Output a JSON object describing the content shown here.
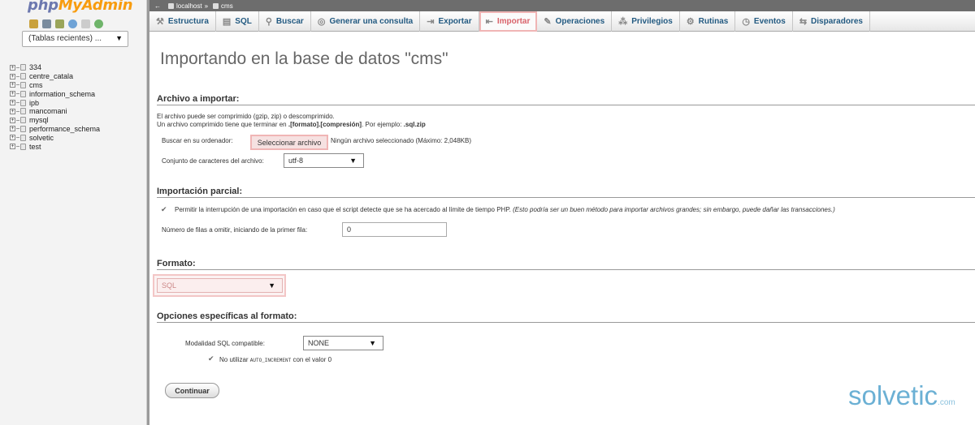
{
  "nav": {
    "logo_a": "php",
    "logo_b": "MyAdmin",
    "recent_label": "(Tablas recientes) ...",
    "databases": [
      "334",
      "centre_catala",
      "cms",
      "information_schema",
      "ipb",
      "mancomani",
      "mysql",
      "performance_schema",
      "solvetic",
      "test"
    ]
  },
  "breadcrumb": {
    "server": "localhost",
    "sep": "»",
    "db": "cms"
  },
  "tabs": [
    {
      "label": "Estructura",
      "icon": "structure-icon"
    },
    {
      "label": "SQL",
      "icon": "sql-icon"
    },
    {
      "label": "Buscar",
      "icon": "search-icon"
    },
    {
      "label": "Generar una consulta",
      "icon": "query-icon"
    },
    {
      "label": "Exportar",
      "icon": "export-icon"
    },
    {
      "label": "Importar",
      "icon": "import-icon"
    },
    {
      "label": "Operaciones",
      "icon": "wrench-icon"
    },
    {
      "label": "Privilegios",
      "icon": "privileges-icon"
    },
    {
      "label": "Rutinas",
      "icon": "routines-icon"
    },
    {
      "label": "Eventos",
      "icon": "clock-icon"
    },
    {
      "label": "Disparadores",
      "icon": "triggers-icon"
    }
  ],
  "page": {
    "title": "Importando en la base de datos \"cms\"",
    "file_section": "Archivo a importar:",
    "file_note1": "El archivo puede ser comprimido (gzip, zip) o descomprimido.",
    "file_note2_a": "Un archivo comprimido tiene que terminar en ",
    "file_note2_b": ".[formato].[compresión]",
    "file_note2_c": ". Por ejemplo: ",
    "file_note2_d": ".sql.zip",
    "browse_label": "Buscar en su ordenador:",
    "browse_button": "Seleccionar archivo",
    "no_file": "Ningún archivo seleccionado (Máximo: 2,048KB)",
    "charset_label": "Conjunto de caracteres del archivo:",
    "charset_value": "utf-8",
    "partial_section": "Importación parcial:",
    "allow_interrupt": "Permitir la interrupción de una importación en caso que el script detecte que se ha acercado al límite de tiempo PHP.",
    "allow_interrupt_note": "(Esto podría ser un buen método para importar archivos grandes; sin embargo, puede dañar las transacciones.)",
    "skip_label": "Número de filas a omitir, iniciando de la primer fila:",
    "skip_value": "0",
    "format_section": "Formato:",
    "format_value": "SQL",
    "options_section": "Opciones específicas al formato:",
    "sql_mode_label": "Modalidad SQL compatible:",
    "sql_mode_value": "NONE",
    "no_auto_a": "No utilizar ",
    "no_auto_b": "AUTO_INCREMENT",
    "no_auto_c": " con el valor 0",
    "continue": "Continuar"
  },
  "watermark": {
    "text": "solvetic",
    "suffix": ".com"
  },
  "colors": {
    "accent_pink": "#f0b5b5",
    "link_blue": "#235a81",
    "logo_blue": "#6c78af",
    "logo_orange": "#f89c0e"
  }
}
